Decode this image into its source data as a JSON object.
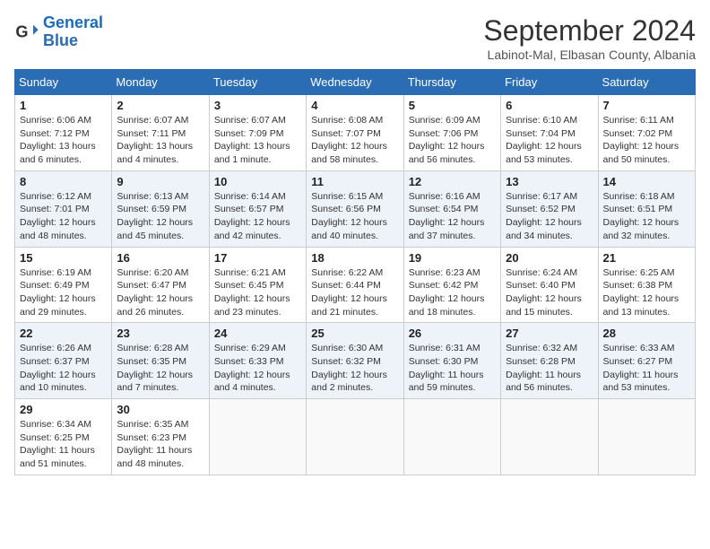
{
  "header": {
    "logo_line1": "General",
    "logo_line2": "Blue",
    "month_year": "September 2024",
    "location": "Labinot-Mal, Elbasan County, Albania"
  },
  "days_of_week": [
    "Sunday",
    "Monday",
    "Tuesday",
    "Wednesday",
    "Thursday",
    "Friday",
    "Saturday"
  ],
  "weeks": [
    [
      {
        "day": 1,
        "info": "Sunrise: 6:06 AM\nSunset: 7:12 PM\nDaylight: 13 hours\nand 6 minutes."
      },
      {
        "day": 2,
        "info": "Sunrise: 6:07 AM\nSunset: 7:11 PM\nDaylight: 13 hours\nand 4 minutes."
      },
      {
        "day": 3,
        "info": "Sunrise: 6:07 AM\nSunset: 7:09 PM\nDaylight: 13 hours\nand 1 minute."
      },
      {
        "day": 4,
        "info": "Sunrise: 6:08 AM\nSunset: 7:07 PM\nDaylight: 12 hours\nand 58 minutes."
      },
      {
        "day": 5,
        "info": "Sunrise: 6:09 AM\nSunset: 7:06 PM\nDaylight: 12 hours\nand 56 minutes."
      },
      {
        "day": 6,
        "info": "Sunrise: 6:10 AM\nSunset: 7:04 PM\nDaylight: 12 hours\nand 53 minutes."
      },
      {
        "day": 7,
        "info": "Sunrise: 6:11 AM\nSunset: 7:02 PM\nDaylight: 12 hours\nand 50 minutes."
      }
    ],
    [
      {
        "day": 8,
        "info": "Sunrise: 6:12 AM\nSunset: 7:01 PM\nDaylight: 12 hours\nand 48 minutes."
      },
      {
        "day": 9,
        "info": "Sunrise: 6:13 AM\nSunset: 6:59 PM\nDaylight: 12 hours\nand 45 minutes."
      },
      {
        "day": 10,
        "info": "Sunrise: 6:14 AM\nSunset: 6:57 PM\nDaylight: 12 hours\nand 42 minutes."
      },
      {
        "day": 11,
        "info": "Sunrise: 6:15 AM\nSunset: 6:56 PM\nDaylight: 12 hours\nand 40 minutes."
      },
      {
        "day": 12,
        "info": "Sunrise: 6:16 AM\nSunset: 6:54 PM\nDaylight: 12 hours\nand 37 minutes."
      },
      {
        "day": 13,
        "info": "Sunrise: 6:17 AM\nSunset: 6:52 PM\nDaylight: 12 hours\nand 34 minutes."
      },
      {
        "day": 14,
        "info": "Sunrise: 6:18 AM\nSunset: 6:51 PM\nDaylight: 12 hours\nand 32 minutes."
      }
    ],
    [
      {
        "day": 15,
        "info": "Sunrise: 6:19 AM\nSunset: 6:49 PM\nDaylight: 12 hours\nand 29 minutes."
      },
      {
        "day": 16,
        "info": "Sunrise: 6:20 AM\nSunset: 6:47 PM\nDaylight: 12 hours\nand 26 minutes."
      },
      {
        "day": 17,
        "info": "Sunrise: 6:21 AM\nSunset: 6:45 PM\nDaylight: 12 hours\nand 23 minutes."
      },
      {
        "day": 18,
        "info": "Sunrise: 6:22 AM\nSunset: 6:44 PM\nDaylight: 12 hours\nand 21 minutes."
      },
      {
        "day": 19,
        "info": "Sunrise: 6:23 AM\nSunset: 6:42 PM\nDaylight: 12 hours\nand 18 minutes."
      },
      {
        "day": 20,
        "info": "Sunrise: 6:24 AM\nSunset: 6:40 PM\nDaylight: 12 hours\nand 15 minutes."
      },
      {
        "day": 21,
        "info": "Sunrise: 6:25 AM\nSunset: 6:38 PM\nDaylight: 12 hours\nand 13 minutes."
      }
    ],
    [
      {
        "day": 22,
        "info": "Sunrise: 6:26 AM\nSunset: 6:37 PM\nDaylight: 12 hours\nand 10 minutes."
      },
      {
        "day": 23,
        "info": "Sunrise: 6:28 AM\nSunset: 6:35 PM\nDaylight: 12 hours\nand 7 minutes."
      },
      {
        "day": 24,
        "info": "Sunrise: 6:29 AM\nSunset: 6:33 PM\nDaylight: 12 hours\nand 4 minutes."
      },
      {
        "day": 25,
        "info": "Sunrise: 6:30 AM\nSunset: 6:32 PM\nDaylight: 12 hours\nand 2 minutes."
      },
      {
        "day": 26,
        "info": "Sunrise: 6:31 AM\nSunset: 6:30 PM\nDaylight: 11 hours\nand 59 minutes."
      },
      {
        "day": 27,
        "info": "Sunrise: 6:32 AM\nSunset: 6:28 PM\nDaylight: 11 hours\nand 56 minutes."
      },
      {
        "day": 28,
        "info": "Sunrise: 6:33 AM\nSunset: 6:27 PM\nDaylight: 11 hours\nand 53 minutes."
      }
    ],
    [
      {
        "day": 29,
        "info": "Sunrise: 6:34 AM\nSunset: 6:25 PM\nDaylight: 11 hours\nand 51 minutes."
      },
      {
        "day": 30,
        "info": "Sunrise: 6:35 AM\nSunset: 6:23 PM\nDaylight: 11 hours\nand 48 minutes."
      },
      null,
      null,
      null,
      null,
      null
    ]
  ]
}
